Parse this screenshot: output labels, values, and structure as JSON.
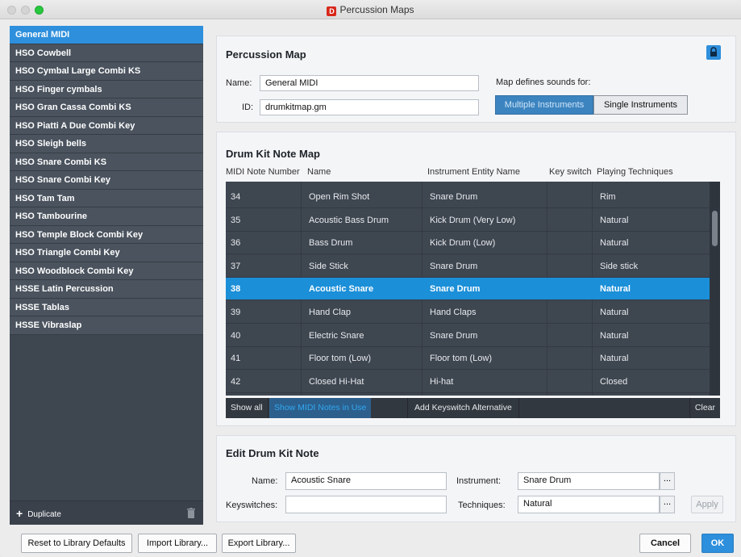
{
  "window": {
    "title": "Percussion Maps",
    "logo_letter": "D"
  },
  "sidebar": {
    "items": [
      "General MIDI",
      "HSO Cowbell",
      "HSO Cymbal Large Combi KS",
      "HSO Finger cymbals",
      "HSO Gran Cassa Combi KS",
      "HSO Piatti A Due Combi Key",
      "HSO Sleigh bells",
      "HSO Snare Combi KS",
      "HSO Snare Combi Key",
      "HSO Tam Tam",
      "HSO Tambourine",
      "HSO Temple Block Combi Key",
      "HSO Triangle Combi Key",
      "HSO Woodblock Combi Key",
      "HSSE Latin Percussion",
      "HSSE Tablas",
      "HSSE Vibraslap"
    ],
    "selected_index": 0,
    "duplicate_label": "Duplicate"
  },
  "percussion_map": {
    "heading": "Percussion Map",
    "name_label": "Name:",
    "name_value": "General MIDI",
    "id_label": "ID:",
    "id_value": "drumkitmap.gm",
    "defines_label": "Map defines sounds for:",
    "multiple_label": "Multiple Instruments",
    "single_label": "Single Instruments"
  },
  "note_map": {
    "heading": "Drum Kit Note Map",
    "columns": [
      "MIDI Note Number",
      "Name",
      "Instrument Entity Name",
      "Key switch",
      "Playing Techniques"
    ],
    "rows": [
      {
        "note": "34",
        "name": "Open Rim Shot",
        "instrument": "Snare Drum",
        "keyswitch": "",
        "technique": "Rim"
      },
      {
        "note": "35",
        "name": "Acoustic Bass Drum",
        "instrument": "Kick Drum (Very Low)",
        "keyswitch": "",
        "technique": "Natural"
      },
      {
        "note": "36",
        "name": "Bass Drum",
        "instrument": "Kick Drum (Low)",
        "keyswitch": "",
        "technique": "Natural"
      },
      {
        "note": "37",
        "name": "Side Stick",
        "instrument": "Snare Drum",
        "keyswitch": "",
        "technique": "Side stick"
      },
      {
        "note": "38",
        "name": "Acoustic Snare",
        "instrument": "Snare Drum",
        "keyswitch": "",
        "technique": "Natural"
      },
      {
        "note": "39",
        "name": "Hand Clap",
        "instrument": "Hand Claps",
        "keyswitch": "",
        "technique": "Natural"
      },
      {
        "note": "40",
        "name": "Electric Snare",
        "instrument": "Snare Drum",
        "keyswitch": "",
        "technique": "Natural"
      },
      {
        "note": "41",
        "name": "Floor tom (Low)",
        "instrument": "Floor tom (Low)",
        "keyswitch": "",
        "technique": "Natural"
      },
      {
        "note": "42",
        "name": "Closed Hi-Hat",
        "instrument": "Hi-hat",
        "keyswitch": "",
        "technique": "Closed"
      }
    ],
    "selected_row": 4,
    "toolbar": {
      "show_all": "Show all",
      "show_in_use": "Show MIDI Notes in Use",
      "add_keyswitch": "Add Keyswitch Alternative",
      "clear": "Clear"
    }
  },
  "edit_note": {
    "heading": "Edit Drum Kit Note",
    "name_label": "Name:",
    "name_value": "Acoustic Snare",
    "instrument_label": "Instrument:",
    "instrument_value": "Snare Drum",
    "keyswitches_label": "Keyswitches:",
    "keyswitches_value": "",
    "techniques_label": "Techniques:",
    "techniques_value": "Natural",
    "dots": "...",
    "apply_label": "Apply"
  },
  "footer": {
    "reset_label": "Reset to Library Defaults",
    "import_label": "Import Library...",
    "export_label": "Export Library...",
    "cancel_label": "Cancel",
    "ok_label": "OK"
  },
  "colors": {
    "accent": "#2e8fdc",
    "sidebar_bg": "#3e4650",
    "table_bg": "#3e4650",
    "selected_row": "#1b8fd8"
  }
}
